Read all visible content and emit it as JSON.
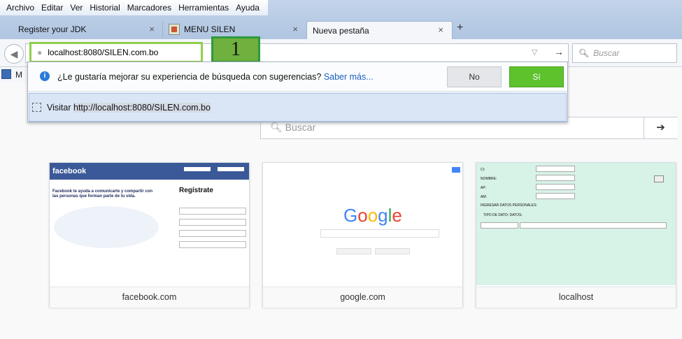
{
  "menu": [
    "Archivo",
    "Editar",
    "Ver",
    "Historial",
    "Marcadores",
    "Herramientas",
    "Ayuda"
  ],
  "tabs": [
    {
      "title": "Register your JDK"
    },
    {
      "title": "MENU SILEN"
    },
    {
      "title": "Nueva pestaña"
    }
  ],
  "tab_close": "×",
  "new_tab": "+",
  "nav": {
    "url": "localhost:8080/SILEN.com.bo",
    "search_placeholder": "Buscar",
    "step_badge": "1",
    "bookmark_label": "M"
  },
  "popup": {
    "suggest_text": "¿Le gustaría mejorar su experiencia de búsqueda con sugerencias?",
    "learn_more": "Saber más...",
    "no_label": "No",
    "yes_label": "Sí",
    "visit_prefix": "Visitar",
    "visit_url": "http://localhost:8080/SILEN.com.bo"
  },
  "content": {
    "search_placeholder": "Buscar"
  },
  "tiles": [
    {
      "label": "facebook.com"
    },
    {
      "label": "google.com"
    },
    {
      "label": "localhost"
    }
  ],
  "fb_thumb": {
    "logo": "facebook",
    "tagline": "Facebook te ayuda a comunicarte y compartir con las personas que forman parte de tu vida.",
    "register": "Regístrate"
  },
  "google_thumb": {
    "logo": "Google"
  },
  "local_thumb": {
    "labels": [
      "CI:",
      "NOMBRE:",
      "AP:",
      "AM:",
      "INGRESAR DATOS PERSONALES:",
      "TIPO DE DATO:    DATOS:"
    ]
  },
  "colors": {
    "accent_green": "#5dc22c",
    "highlight_border": "#8fcf4d",
    "badge": "#6fb03f"
  }
}
